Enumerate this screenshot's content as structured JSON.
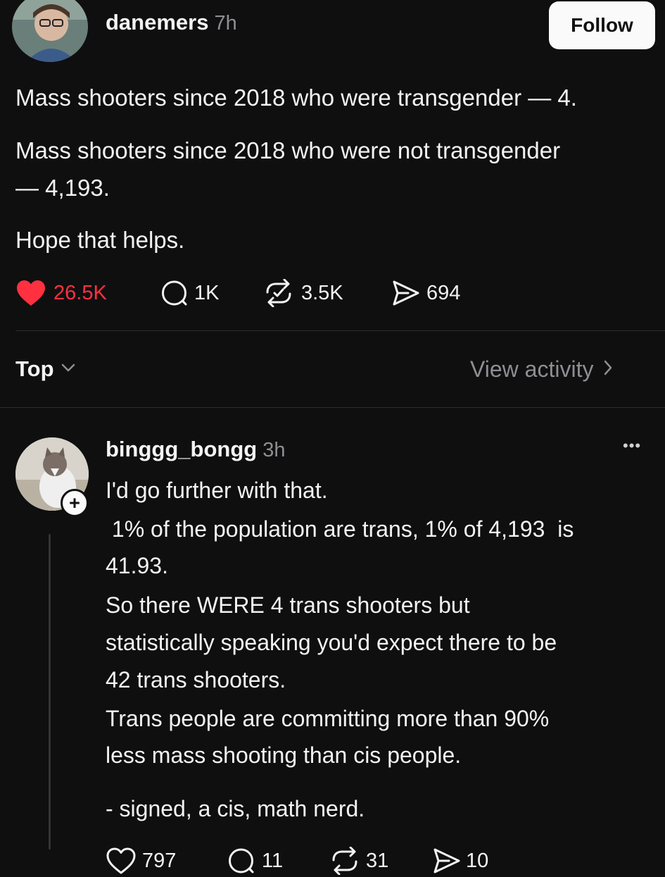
{
  "post": {
    "author": "danemers",
    "time": "7h",
    "follow_label": "Follow",
    "paragraphs": [
      "Mass shooters since 2018 who were transgender — 4.",
      "Mass shooters since 2018 who were not transgender",
      "— 4,193.",
      "Hope that helps."
    ],
    "likes": "26.5K",
    "replies": "1K",
    "reposts": "3.5K",
    "shares": "694",
    "liked": true
  },
  "sort": {
    "label": "Top",
    "activity_label": "View activity"
  },
  "reply": {
    "author": "binggg_bongg",
    "time": "3h",
    "more": "•••",
    "add_label": "+",
    "lines": [
      "I'd go further with that.",
      " 1% of the population are trans, 1% of 4,193  is",
      "41.93.",
      "So there WERE 4 trans shooters but",
      "statistically speaking you'd expect there to be",
      "42 trans shooters.",
      "Trans people are committing more than 90%",
      "less mass shooting than cis people.",
      "- signed, a cis, math nerd."
    ],
    "likes": "797",
    "replies": "11",
    "reposts": "31",
    "shares": "10"
  },
  "colors": {
    "background": "#0f0f10",
    "like_red": "#ff3040",
    "muted": "#8e8e93"
  }
}
